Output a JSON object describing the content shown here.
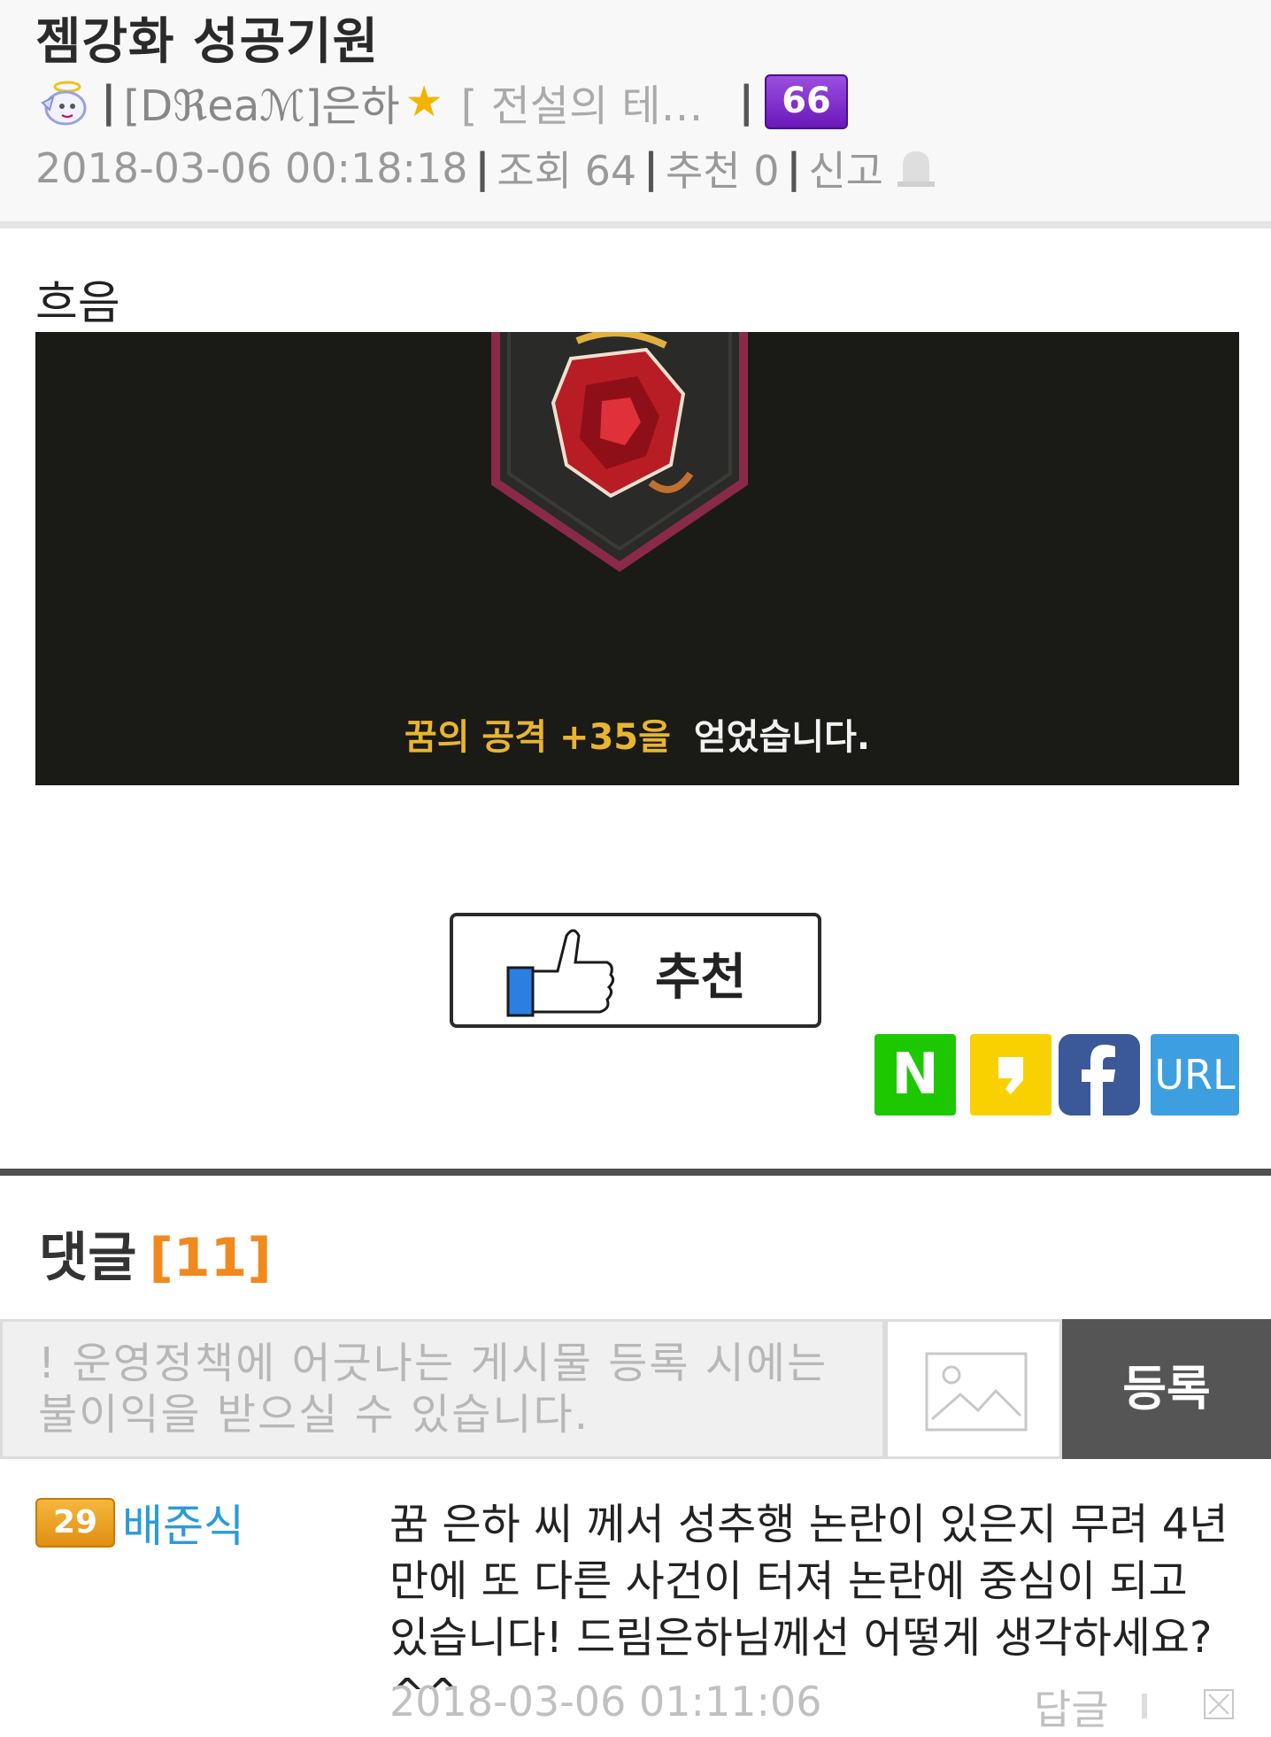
{
  "post": {
    "title": "젬강화 성공기원",
    "author_name": "[Dℜeaℳ]은하",
    "author_star": "★",
    "author_guild": "[ 전설의 테…",
    "level_badge": "66",
    "meta": {
      "date": "2018-03-06 00:18:18",
      "views": "조회 64",
      "recommend": "추천 0",
      "report": "신고"
    },
    "body_text": "흐음",
    "image_caption_gold": "꿈의 공격 +35을",
    "image_caption_white": "얻었습니다."
  },
  "recommend_button": {
    "label": "추천"
  },
  "share": {
    "naver": "N",
    "url": "URL"
  },
  "comments": {
    "title": "댓글",
    "count": "[11]",
    "input_placeholder": "! 운영정책에 어긋나는 게시물 등록 시에는 불이익을 받으실 수 있습니다.",
    "register_label": "등록",
    "items": [
      {
        "level": "29",
        "name": "배준식",
        "text": "꿈 은하 씨 께서 성추행 논란이 있은지 무려 4년만에 또 다른 사건이 터져 논란에 중심이 되고 있습니다! 드림은하님께선 어떻게 생각하세요?^^",
        "date": "2018-03-06 01:11:06",
        "reply_label": "답글"
      }
    ]
  },
  "colors": {
    "accent_orange": "#f08a1e",
    "link_blue": "#2a9bd8",
    "naver_green": "#1ec800",
    "kakao_yellow": "#f9d100",
    "facebook_blue": "#3b5998",
    "url_blue": "#3d9fe0"
  },
  "icons": {
    "avatar": "angel-avatar-icon",
    "report": "bell-icon",
    "recommend": "thumbs-up-icon",
    "image": "image-attach-icon",
    "delete": "delete-x-icon"
  }
}
